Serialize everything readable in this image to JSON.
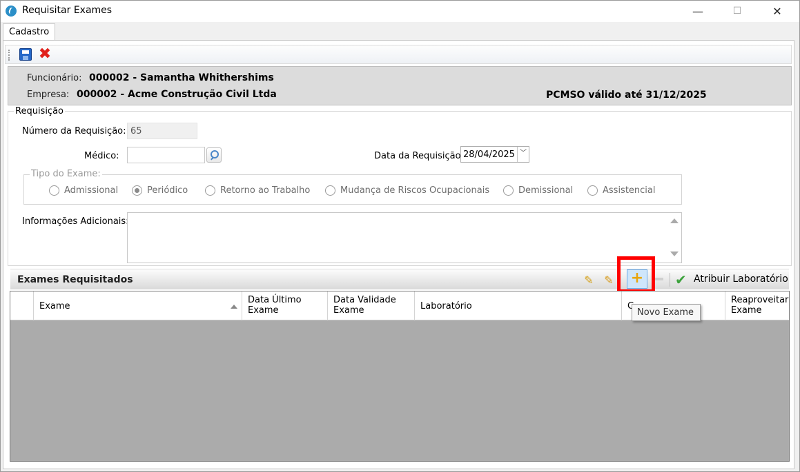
{
  "window": {
    "title": "Requisitar Exames",
    "minimize": "—",
    "maximize": "☐",
    "close": "✕"
  },
  "tabs": [
    {
      "label": "Cadastro"
    }
  ],
  "info": {
    "funcionario_label": "Funcionário:",
    "funcionario_value": "000002 - Samantha Whithershims",
    "empresa_label": "Empresa:",
    "empresa_value": "000002 - Acme Construção Civil Ltda",
    "pcmso": "PCMSO válido até 31/12/2025"
  },
  "requisicao": {
    "legend": "Requisição",
    "numero_label": "Número da Requisição:",
    "numero_value": "65",
    "medico_label": "Médico:",
    "medico_value": "",
    "data_label": "Data da Requisição:",
    "data_value": "28/04/2025",
    "tipo_legend": "Tipo do Exame:",
    "tipos": [
      {
        "label": "Admissional",
        "checked": false
      },
      {
        "label": "Periódico",
        "checked": true
      },
      {
        "label": "Retorno ao Trabalho",
        "checked": false
      },
      {
        "label": "Mudança de Riscos Ocupacionais",
        "checked": false
      },
      {
        "label": "Demissional",
        "checked": false
      },
      {
        "label": "Assistencial",
        "checked": false
      }
    ],
    "info_adicionais_label": "Informações Adicionais:"
  },
  "exames": {
    "title": "Exames Requisitados",
    "atribuir_label": "Atribuir Laboratório",
    "columns": [
      {
        "label": ""
      },
      {
        "label": "Exame"
      },
      {
        "label": "Data Último Exame"
      },
      {
        "label": "Data Validade Exame"
      },
      {
        "label": "Laboratório"
      },
      {
        "label": "C"
      },
      {
        "label": "Reaproveitar Exame"
      }
    ],
    "tooltip": "Novo Exame"
  },
  "icons": {
    "save": "save-icon",
    "cancel": "cancel-icon",
    "add": "plus-icon",
    "check": "check-icon"
  },
  "colors": {
    "highlight": "#ff0000",
    "grid_background": "#ababab",
    "accent_blue": "#2367c8"
  }
}
